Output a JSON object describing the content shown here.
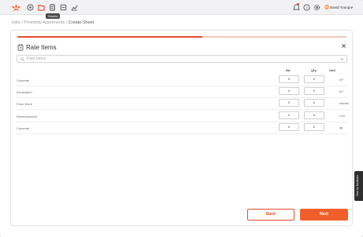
{
  "topbar": {
    "tooltip": "Sheets",
    "user": {
      "initials": "DY",
      "name": "David Young"
    },
    "icons": [
      "logo-icon",
      "dashboard-icon",
      "folder-icon",
      "sheets-icon",
      "file-icon",
      "chart-icon",
      "bell-icon",
      "help-icon",
      "settings-icon"
    ],
    "accent": "#e8492a"
  },
  "breadcrumb": {
    "items": [
      "Jobs",
      "Proximity Apartments"
    ],
    "separator": "/",
    "current": "Create Sheet"
  },
  "progress": {
    "fraction": 0.56
  },
  "panel": {
    "title": "Rate Items",
    "search_placeholder": "Rate Items"
  },
  "table": {
    "headers": {
      "no": "No.",
      "qty": "Qty",
      "unit": "Unit"
    },
    "rows": [
      {
        "label": "Concrete",
        "no": "0",
        "qty": "0",
        "unit": "m³"
      },
      {
        "label": "Excavation",
        "no": "0",
        "qty": "0",
        "unit": "m³"
      },
      {
        "label": "Form Work",
        "no": "0",
        "qty": "0",
        "unit": "sheets"
      },
      {
        "label": "Reinforcement",
        "no": "0",
        "qty": "0",
        "unit": "L/M"
      },
      {
        "label": "Concrete",
        "no": "0",
        "qty": "0",
        "unit": "kg"
      }
    ]
  },
  "buttons": {
    "back": "Back",
    "next": "Next"
  },
  "feedback": {
    "label": "Give us feedback"
  }
}
